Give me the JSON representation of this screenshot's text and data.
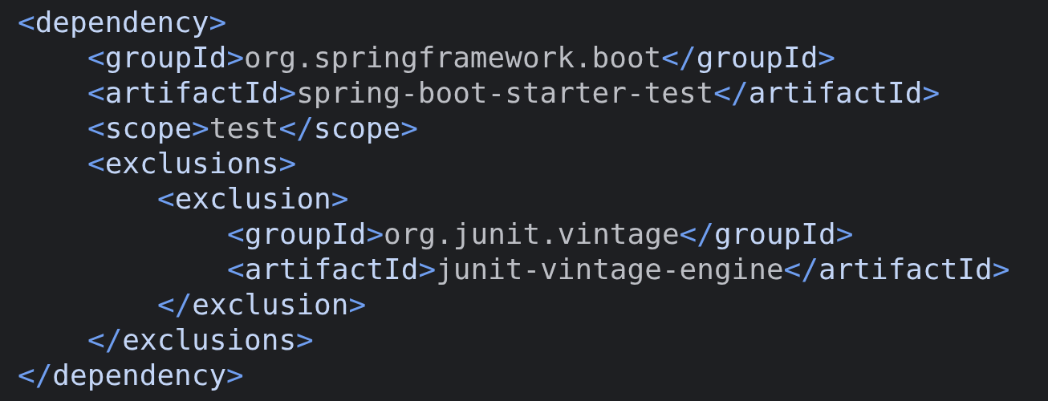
{
  "editor": {
    "root": {
      "open": {
        "lt": "<",
        "name": "dependency",
        "gt": ">"
      },
      "close": {
        "lt": "</",
        "name": "dependency",
        "gt": ">"
      },
      "children": [
        {
          "open": {
            "lt": "<",
            "name": "groupId",
            "gt": ">"
          },
          "value": "org.springframework.boot",
          "close": {
            "lt": "</",
            "name": "groupId",
            "gt": ">"
          }
        },
        {
          "open": {
            "lt": "<",
            "name": "artifactId",
            "gt": ">"
          },
          "value": "spring-boot-starter-test",
          "close": {
            "lt": "</",
            "name": "artifactId",
            "gt": ">"
          }
        },
        {
          "open": {
            "lt": "<",
            "name": "scope",
            "gt": ">"
          },
          "value": "test",
          "close": {
            "lt": "</",
            "name": "scope",
            "gt": ">"
          }
        },
        {
          "open": {
            "lt": "<",
            "name": "exclusions",
            "gt": ">"
          },
          "close": {
            "lt": "</",
            "name": "exclusions",
            "gt": ">"
          },
          "children": [
            {
              "open": {
                "lt": "<",
                "name": "exclusion",
                "gt": ">"
              },
              "close": {
                "lt": "</",
                "name": "exclusion",
                "gt": ">"
              },
              "children": [
                {
                  "open": {
                    "lt": "<",
                    "name": "groupId",
                    "gt": ">"
                  },
                  "value": "org.junit.vintage",
                  "close": {
                    "lt": "</",
                    "name": "groupId",
                    "gt": ">"
                  }
                },
                {
                  "open": {
                    "lt": "<",
                    "name": "artifactId",
                    "gt": ">"
                  },
                  "value": "junit-vintage-engine",
                  "close": {
                    "lt": "</",
                    "name": "artifactId",
                    "gt": ">"
                  }
                }
              ]
            }
          ]
        }
      ]
    }
  }
}
